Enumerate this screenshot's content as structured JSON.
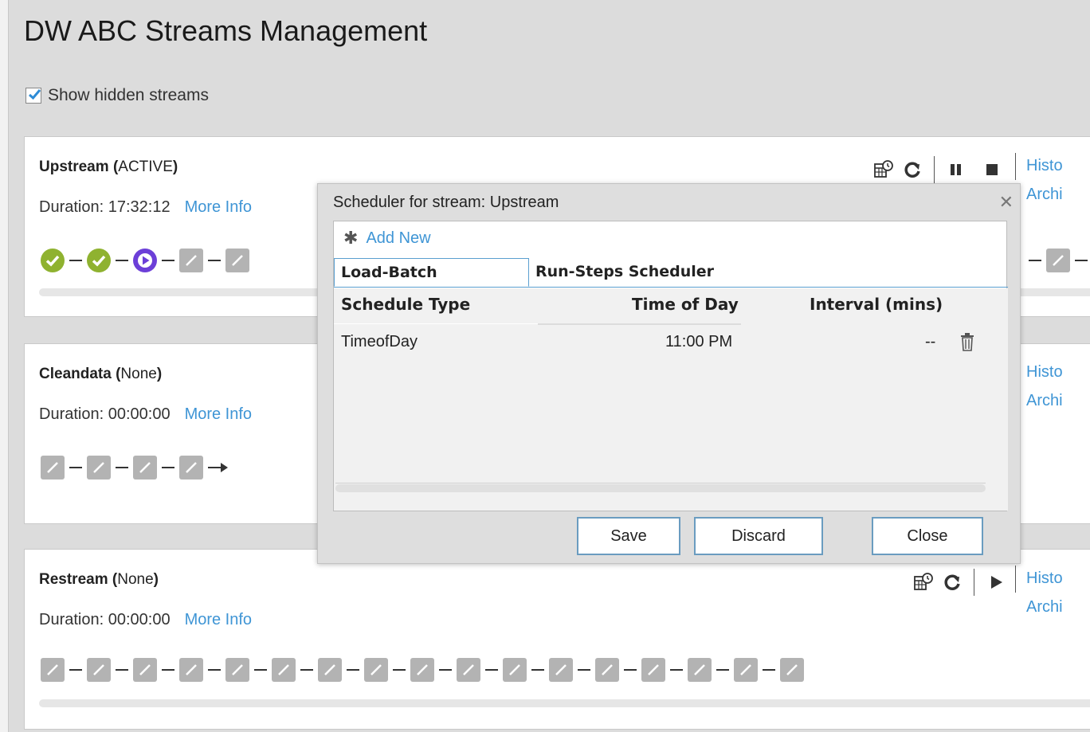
{
  "page": {
    "title": "DW ABC Streams Management",
    "show_hidden_label": "Show hidden streams"
  },
  "streams": [
    {
      "name": "Upstream",
      "status": "ACTIVE",
      "duration": "Duration: 17:32:12",
      "more_info": "More Info"
    },
    {
      "name": "Cleandata",
      "status": "None",
      "duration": "Duration: 00:00:00",
      "more_info": "More Info"
    },
    {
      "name": "Restream",
      "status": "None",
      "duration": "Duration: 00:00:00",
      "more_info": "More Info"
    }
  ],
  "side_links": {
    "history": "Histo",
    "archive": "Archi"
  },
  "dialog": {
    "title": "Scheduler for stream: Upstream",
    "add_new": "Add New",
    "tabs": [
      "Load-Batch Scheduler",
      "Run-Steps Scheduler"
    ],
    "columns": [
      "Schedule Type",
      "Time of Day",
      "Interval (mins)"
    ],
    "rows": [
      {
        "type": "TimeofDay",
        "time": "11:00 PM",
        "interval": "--"
      }
    ],
    "buttons": {
      "save": "Save",
      "discard": "Discard",
      "close": "Close"
    }
  },
  "colors": {
    "link": "#3f95d5",
    "step_done": "#8fb230",
    "step_running": "#6c3fd8",
    "step_pending": "#b3b3b3"
  },
  "icons": [
    "checkbox-checked-icon",
    "calendar-clock-icon",
    "refresh-icon",
    "pause-icon",
    "stop-icon",
    "play-icon",
    "close-icon",
    "asterisk-icon",
    "trash-icon",
    "check-circle-icon",
    "play-circle-icon",
    "pencil-icon"
  ]
}
